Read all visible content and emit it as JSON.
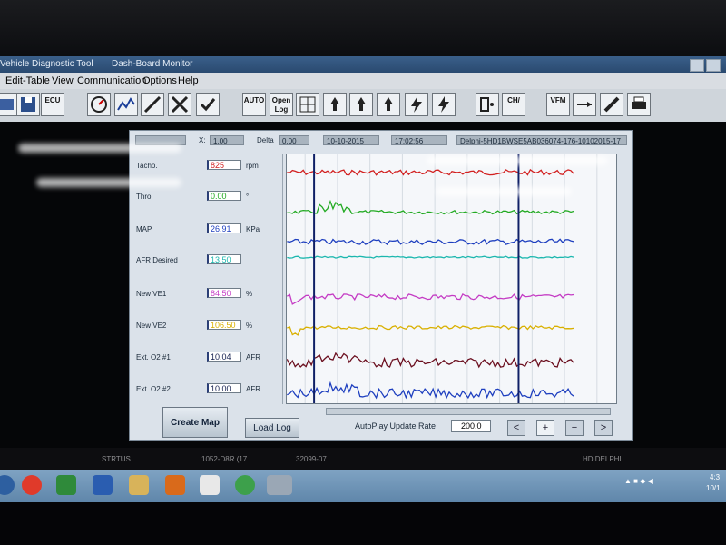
{
  "window": {
    "title_left": "Vehicle Diagnostic Tool",
    "title_right": "Dash-Board Monitor"
  },
  "menu": [
    "Edit-Table",
    "View",
    "Communication",
    "Options",
    "Help"
  ],
  "toolbar": {
    "open_log": "Open Log",
    "ch_label": "CH/",
    "vfm_label": "VFM",
    "ecu_label": "ECU",
    "auto_label": "AUTO"
  },
  "header": {
    "x_label": "X:",
    "x_value": "1.00",
    "delta_label": "Delta",
    "delta_value": "0.00",
    "date": "10-10-2015",
    "time": "17:02:56",
    "log_name": "Delphi-5HD1BWSE5AB036074-176-10102015-17"
  },
  "readings": [
    {
      "label": "Tacho.",
      "value": "825",
      "unit": "rpm",
      "color": "#d22020"
    },
    {
      "label": "Thro.",
      "value": "0.00",
      "unit": "°",
      "color": "#22aa22"
    },
    {
      "label": "MAP",
      "value": "26.91",
      "unit": "KPa",
      "color": "#1e3fbf"
    },
    {
      "label": "AFR Desired",
      "value": "13.50",
      "unit": "",
      "color": "#1bb7ae"
    },
    {
      "label": "New VE1",
      "value": "84.50",
      "unit": "%",
      "color": "#c43bc4"
    },
    {
      "label": "New VE2",
      "value": "106.50",
      "unit": "%",
      "color": "#d9b000"
    },
    {
      "label": "Ext. O2 #1",
      "value": "10.04",
      "unit": "AFR",
      "color": "#152050"
    },
    {
      "label": "Ext. O2 #2",
      "value": "10.00",
      "unit": "AFR",
      "color": "#152050"
    }
  ],
  "scales": [
    {
      "top": "8000",
      "bottom": "0",
      "color": "#d22020"
    },
    {
      "top": "100",
      "bottom": "0",
      "color": "#22aa22"
    },
    {
      "top": "255",
      "bottom": "0",
      "color": "#1e3fbf"
    },
    {
      "top": "18",
      "bottom": "0",
      "color": "#1bb7ae"
    },
    {
      "top": "255",
      "bottom": "0",
      "color": "#c43bc4"
    },
    {
      "top": "255",
      "bottom": "0",
      "color": "#d9b000"
    },
    {
      "top": "23",
      "bottom": "10",
      "color": "#6b0f1f"
    },
    {
      "top": "23",
      "bottom": "10",
      "color": "#1e3fbf"
    }
  ],
  "traces": [
    {
      "name": "Tacho",
      "color": "#d22020"
    },
    {
      "name": "Throttle",
      "color": "#22aa22"
    },
    {
      "name": "MAP",
      "color": "#1e3fbf"
    },
    {
      "name": "AFR Desired",
      "color": "#1bb7ae"
    },
    {
      "name": "New VE1",
      "color": "#c43bc4"
    },
    {
      "name": "New VE2",
      "color": "#d9b000"
    },
    {
      "name": "Ext O2 1",
      "color": "#6b0f1f"
    },
    {
      "name": "Ext O2 2",
      "color": "#1e3fbf"
    }
  ],
  "buttons": {
    "create_map": "Create Map",
    "load_log": "Load Log",
    "prev": "<",
    "plus": "+",
    "minus": "−",
    "next": ">"
  },
  "autoplay": {
    "label": "AutoPlay Update Rate",
    "value": "200.0"
  },
  "bezel_text": [
    "STRTUS",
    "1052-D8R.(17",
    "32099-07",
    "HD DELPHI"
  ],
  "taskbar": {
    "clock": "4:3",
    "date": "10/1"
  }
}
